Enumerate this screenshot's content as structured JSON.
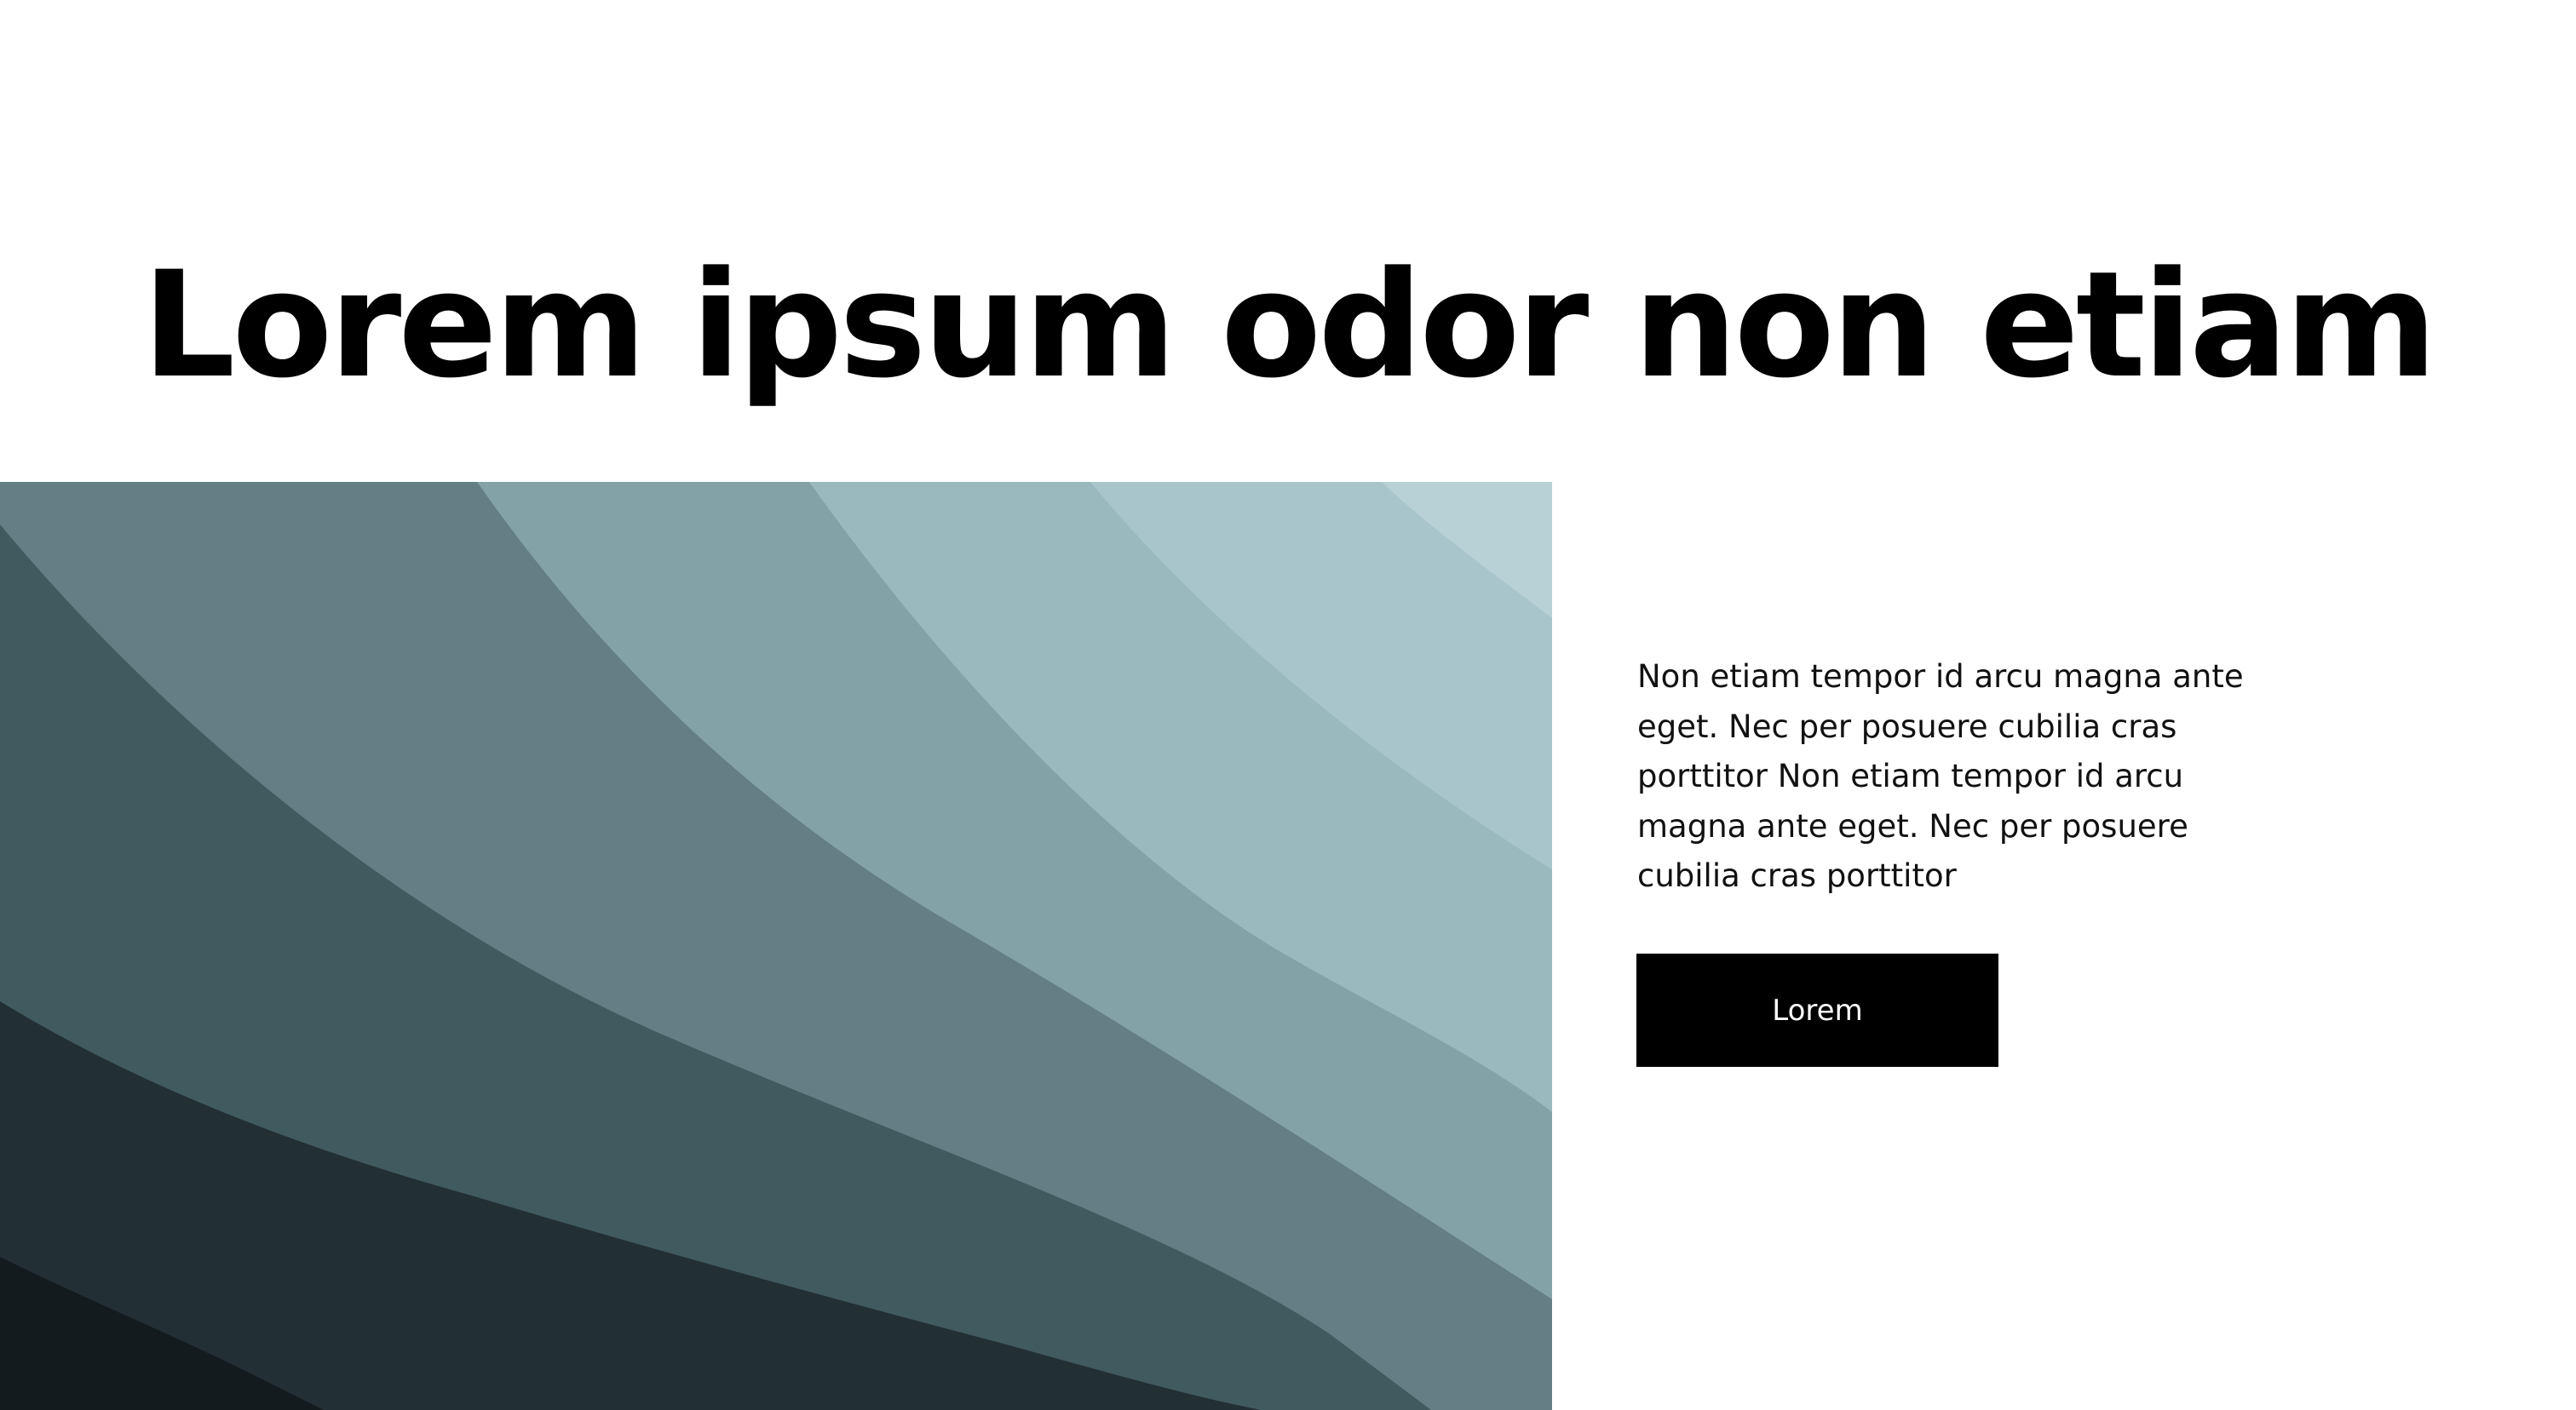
{
  "hero": {
    "title": "Lorem ipsum odor non etiam",
    "body": "Non etiam tempor id arcu magna ante eget. Nec per posuere cubilia cras porttitor Non etiam tempor id arcu magna ante eget. Nec per posuere cubilia cras porttitor",
    "button_label": "Lorem"
  },
  "art": {
    "description_icon": "abstract-wave-image",
    "colors": [
      "#b8d1d7",
      "#a8c5cc",
      "#9ab9bf",
      "#82a2a8",
      "#637e84",
      "#415a60",
      "#222f35",
      "#131b1e"
    ]
  }
}
